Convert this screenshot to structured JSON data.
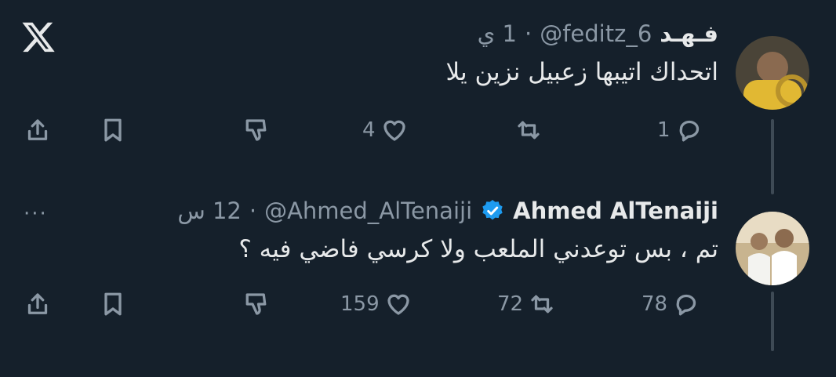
{
  "brand": {
    "logo_icon": "x-logo-icon"
  },
  "tweets": [
    {
      "name": "فـهـد",
      "handle": "@feditz_6",
      "separator": "·",
      "time": "1 ي",
      "text": "اتحداك اتيبها زعبيل نزين يلا",
      "verified": false,
      "stats": {
        "replies": "1",
        "reposts": "",
        "likes": "4"
      }
    },
    {
      "name": "Ahmed AlTenaiji",
      "handle": "@Ahmed_AlTenaiji",
      "separator": "·",
      "time": "12 س",
      "text": "تم ، بس توعدني الملعب ولا كرسي فاضي فيه ؟",
      "verified": true,
      "stats": {
        "replies": "78",
        "reposts": "72",
        "likes": "159"
      },
      "more": "···"
    }
  ],
  "colors": {
    "background": "#15202b",
    "muted": "#8b98a5",
    "verified": "#1d9bf0"
  }
}
